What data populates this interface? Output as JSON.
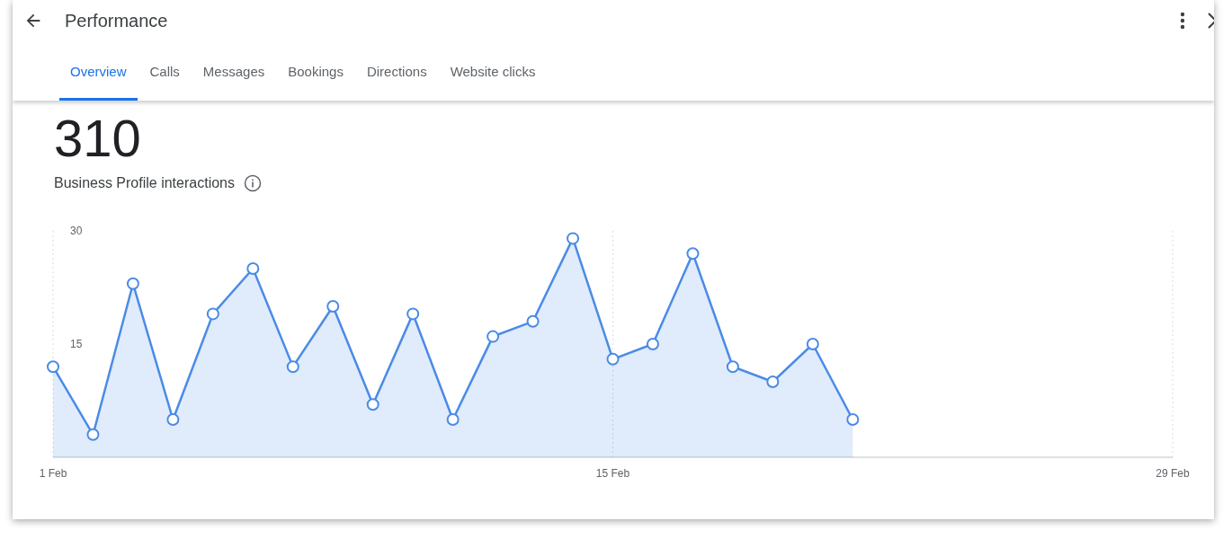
{
  "header": {
    "title": "Performance"
  },
  "tabs": [
    {
      "label": "Overview",
      "selected": true
    },
    {
      "label": "Calls",
      "selected": false
    },
    {
      "label": "Messages",
      "selected": false
    },
    {
      "label": "Bookings",
      "selected": false
    },
    {
      "label": "Directions",
      "selected": false
    },
    {
      "label": "Website clicks",
      "selected": false
    }
  ],
  "summary": {
    "total": "310",
    "label": "Business Profile interactions"
  },
  "chart_data": {
    "type": "area",
    "categories": [
      "1 Feb",
      null,
      null,
      null,
      null,
      null,
      null,
      null,
      null,
      null,
      null,
      null,
      null,
      null,
      "15 Feb",
      null,
      null,
      null,
      null,
      null,
      null,
      null,
      null,
      null,
      null,
      null,
      null,
      null,
      "29 Feb"
    ],
    "ylim": [
      0,
      30
    ],
    "yticks": [
      15,
      30
    ],
    "series": [
      {
        "color": "#4a8be6",
        "values": [
          12,
          3,
          23,
          5,
          19,
          25,
          12,
          20,
          7,
          19,
          5,
          16,
          18,
          29,
          13,
          15,
          27,
          12,
          10,
          15,
          5,
          null,
          null,
          null,
          null,
          null,
          null,
          null,
          null
        ]
      }
    ]
  }
}
